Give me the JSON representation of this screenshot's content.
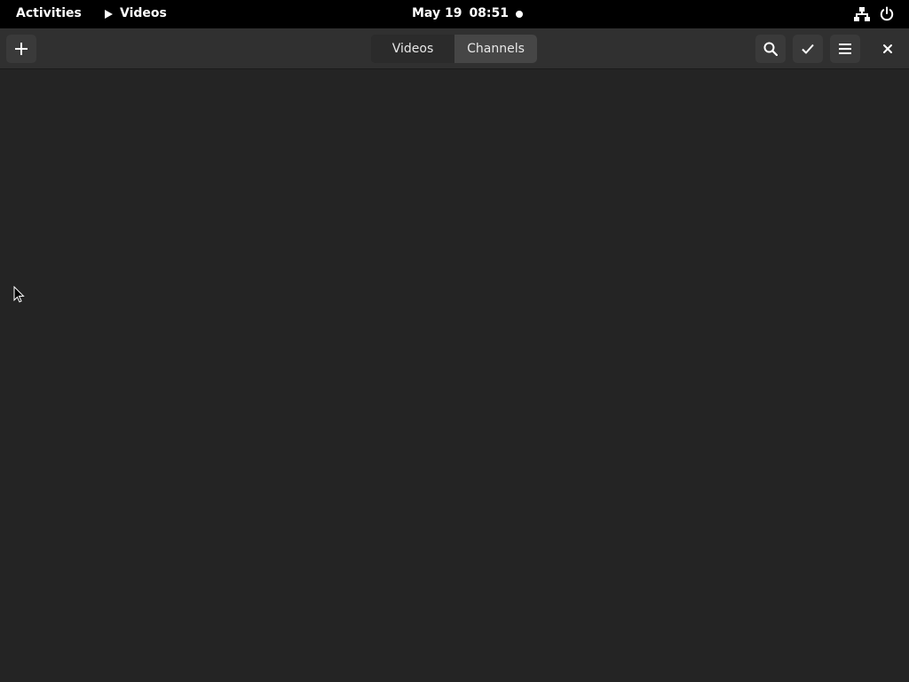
{
  "topbar": {
    "activities": "Activities",
    "app_name": "Videos",
    "date": "May 19",
    "time": "08:51"
  },
  "headerbar": {
    "tabs": [
      {
        "label": "Videos",
        "active": false
      },
      {
        "label": "Channels",
        "active": true
      }
    ],
    "icons": {
      "add": "plus-icon",
      "search": "search-icon",
      "select": "checkmark-icon",
      "menu": "hamburger-menu-icon",
      "close": "close-icon"
    }
  },
  "colors": {
    "topbar_bg": "#000000",
    "headerbar_bg": "#303030",
    "content_bg": "#242424",
    "active_tab_bg": "#464646"
  }
}
